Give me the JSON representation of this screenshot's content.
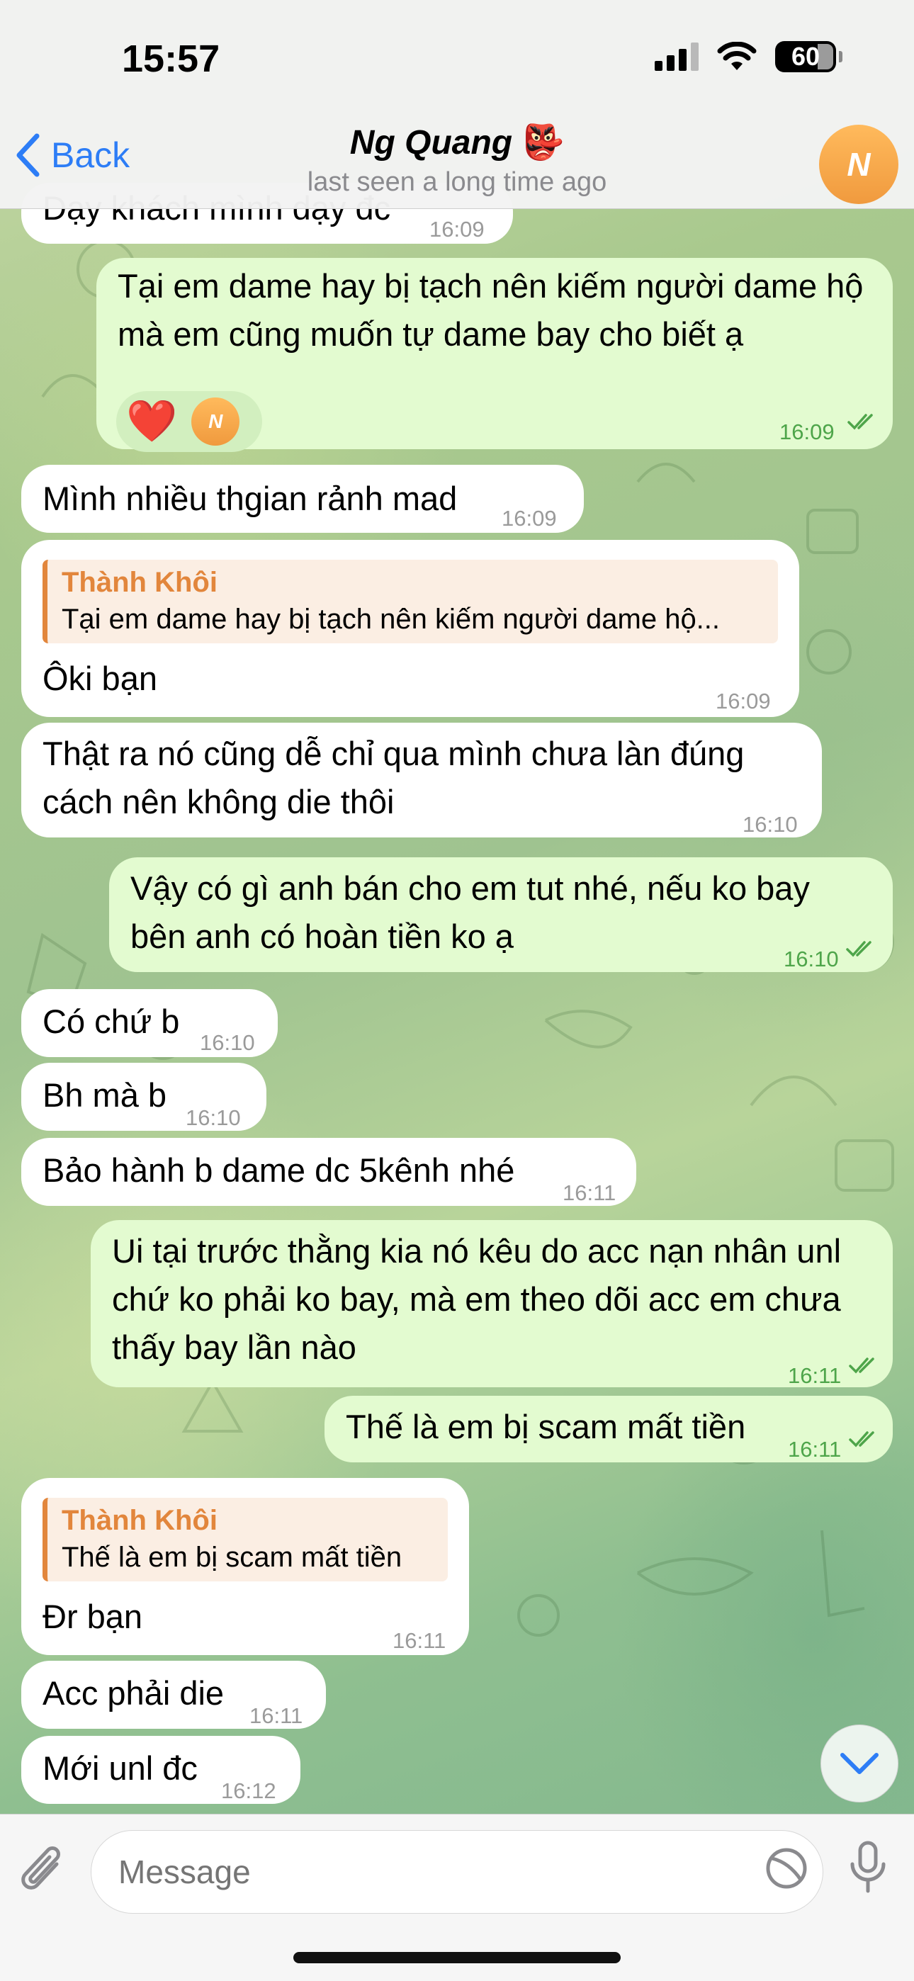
{
  "status": {
    "time": "15:57",
    "battery": "60"
  },
  "header": {
    "back_label": "Back",
    "title": "Ng Quang",
    "title_emoji": "👺",
    "subtitle": "last seen a long time ago",
    "avatar_letter": "N"
  },
  "messages": [
    {
      "dir": "in",
      "text": "Dạy khách mình dạy đc",
      "time": "16:09"
    },
    {
      "dir": "out",
      "text": "Tại em dame hay bị tạch nên kiếm người dame hộ mà em cũng muốn tự dame bay cho biết ạ",
      "time": "16:09",
      "reaction": {
        "emoji": "❤️",
        "avatar_letter": "N"
      }
    },
    {
      "dir": "in",
      "text": "Mình nhiều thgian rảnh mad",
      "time": "16:09"
    },
    {
      "dir": "in",
      "reply_name": "Thành Khôi",
      "reply_text": "Tại em dame hay bị tạch nên kiếm người dame hộ...",
      "text": "Ôki bạn",
      "time": "16:09"
    },
    {
      "dir": "in",
      "text": "Thật ra nó cũng dễ chỉ qua mình chưa làn đúng cách nên không die thôi",
      "time": "16:10"
    },
    {
      "dir": "out",
      "text": "Vậy có gì anh bán cho em tut nhé, nếu ko bay bên anh có hoàn tiền ko ạ",
      "time": "16:10"
    },
    {
      "dir": "in",
      "text": "Có chứ b",
      "time": "16:10"
    },
    {
      "dir": "in",
      "text": "Bh mà b",
      "time": "16:10"
    },
    {
      "dir": "in",
      "text": "Bảo hành b dame dc 5kênh nhé",
      "time": "16:11"
    },
    {
      "dir": "out",
      "text": "Ui tại trước thằng kia nó kêu do acc nạn nhân unl chứ ko phải ko bay, mà em theo dõi acc em chưa thấy bay lần nào",
      "time": "16:11"
    },
    {
      "dir": "out",
      "text": "Thế là em bị scam mất tiền",
      "time": "16:11"
    },
    {
      "dir": "in",
      "reply_name": "Thành Khôi",
      "reply_text": "Thế là em bị scam mất tiền",
      "text": "Đr bạn",
      "time": "16:11"
    },
    {
      "dir": "in",
      "text": "Acc phải die",
      "time": "16:11"
    },
    {
      "dir": "in",
      "text": "Mới unl đc",
      "time": "16:12"
    }
  ],
  "input": {
    "placeholder": "Message"
  },
  "icons": {
    "back": "chevron-left-icon",
    "attach": "paperclip-icon",
    "sticker": "sticker-icon",
    "mic": "microphone-icon",
    "scroll": "chevron-down-icon",
    "read": "double-check-icon"
  },
  "colors": {
    "accent": "#2d7df6",
    "outgoing_bubble": "#e3fbd0",
    "incoming_bubble": "#ffffff",
    "reply_accent": "#e2863c",
    "read_ticks": "#4ea54a"
  }
}
